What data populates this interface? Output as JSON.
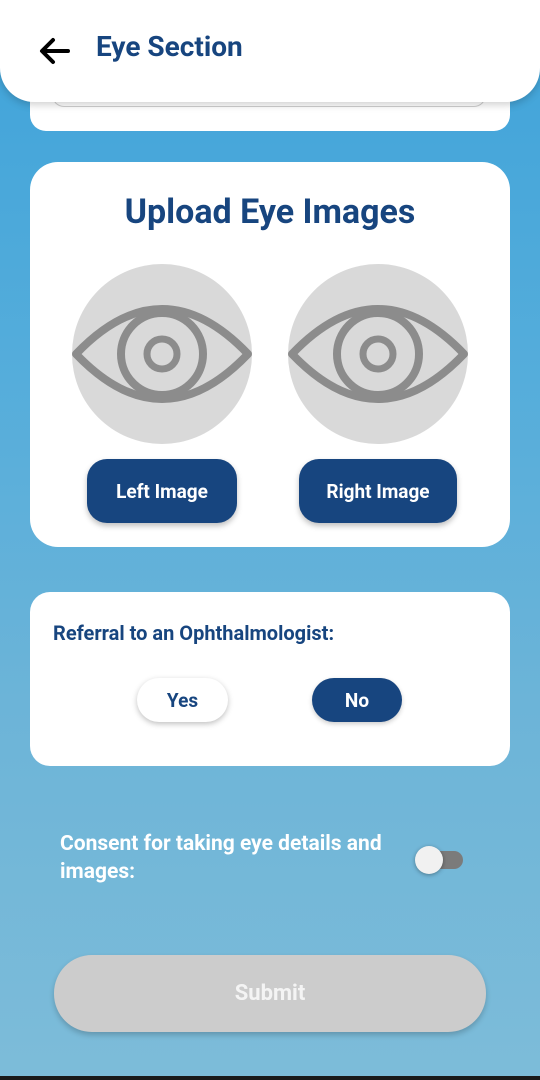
{
  "header": {
    "title": "Eye Section",
    "back_icon": "arrow-left-icon"
  },
  "upload": {
    "title": "Upload Eye Images",
    "placeholder_icon": "eye-icon",
    "left_button": "Left Image",
    "right_button": "Right Image"
  },
  "referral": {
    "label": "Referral to an Ophthalmologist:",
    "options": [
      {
        "label": "Yes",
        "selected": false
      },
      {
        "label": "No",
        "selected": true
      }
    ]
  },
  "consent": {
    "label": "Consent for taking eye details and images:",
    "enabled": false
  },
  "submit": {
    "label": "Submit",
    "disabled": true
  },
  "colors": {
    "primary": "#17457f",
    "background_top": "#3fa3d9",
    "background_bottom": "#7dbcd9",
    "disabled": "#cccccc"
  }
}
